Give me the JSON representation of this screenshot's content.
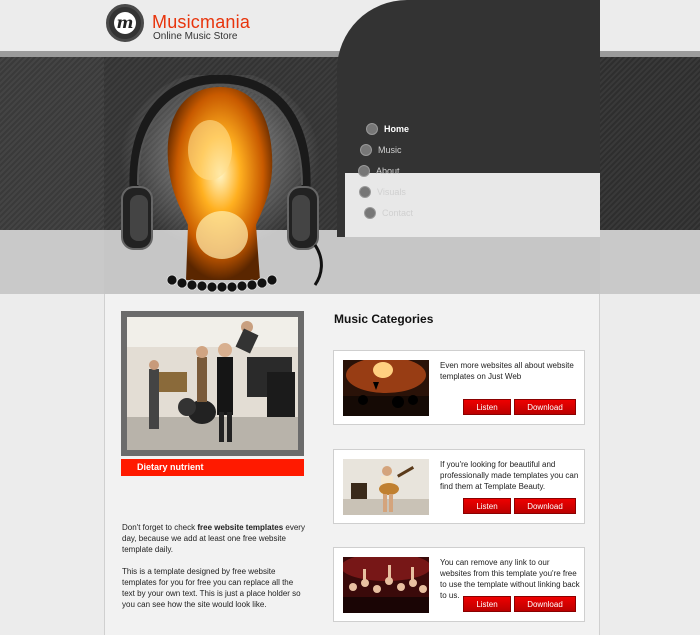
{
  "header": {
    "logo_letter": "m",
    "title": "Musicmania",
    "subtitle": "Online Music Store"
  },
  "nav": {
    "items": [
      {
        "label": "Home",
        "active": true
      },
      {
        "label": "Music",
        "active": false
      },
      {
        "label": "About",
        "active": false
      },
      {
        "label": "Visuals",
        "active": false
      },
      {
        "label": "Contact",
        "active": false
      }
    ]
  },
  "sidebar": {
    "caption": "Dietary nutrient",
    "paragraph1_pre": "Don't forget to check ",
    "paragraph1_bold": "free website templates",
    "paragraph1_post": " every day, because we add at least one free website template daily.",
    "paragraph2": "This is a template designed by free website templates for you for free you can replace all the text by your own text. This is just a place holder so you can see how the site would look like."
  },
  "main": {
    "section_title": "Music Categories",
    "cards": [
      {
        "text": "Even more websites all about website templates on Just Web",
        "listen": "Listen",
        "download": "Download"
      },
      {
        "text": "If you're looking for beautiful and professionally made templates you can find them at Template Beauty.",
        "listen": "Listen",
        "download": "Download"
      },
      {
        "text": "You can remove any link to our websites from this template you're free to use the template without linking back to us.",
        "listen": "Listen",
        "download": "Download"
      }
    ]
  },
  "colors": {
    "brand": "#e8340c",
    "button_red": "#dd0000",
    "caption_red": "#ff1a00"
  }
}
